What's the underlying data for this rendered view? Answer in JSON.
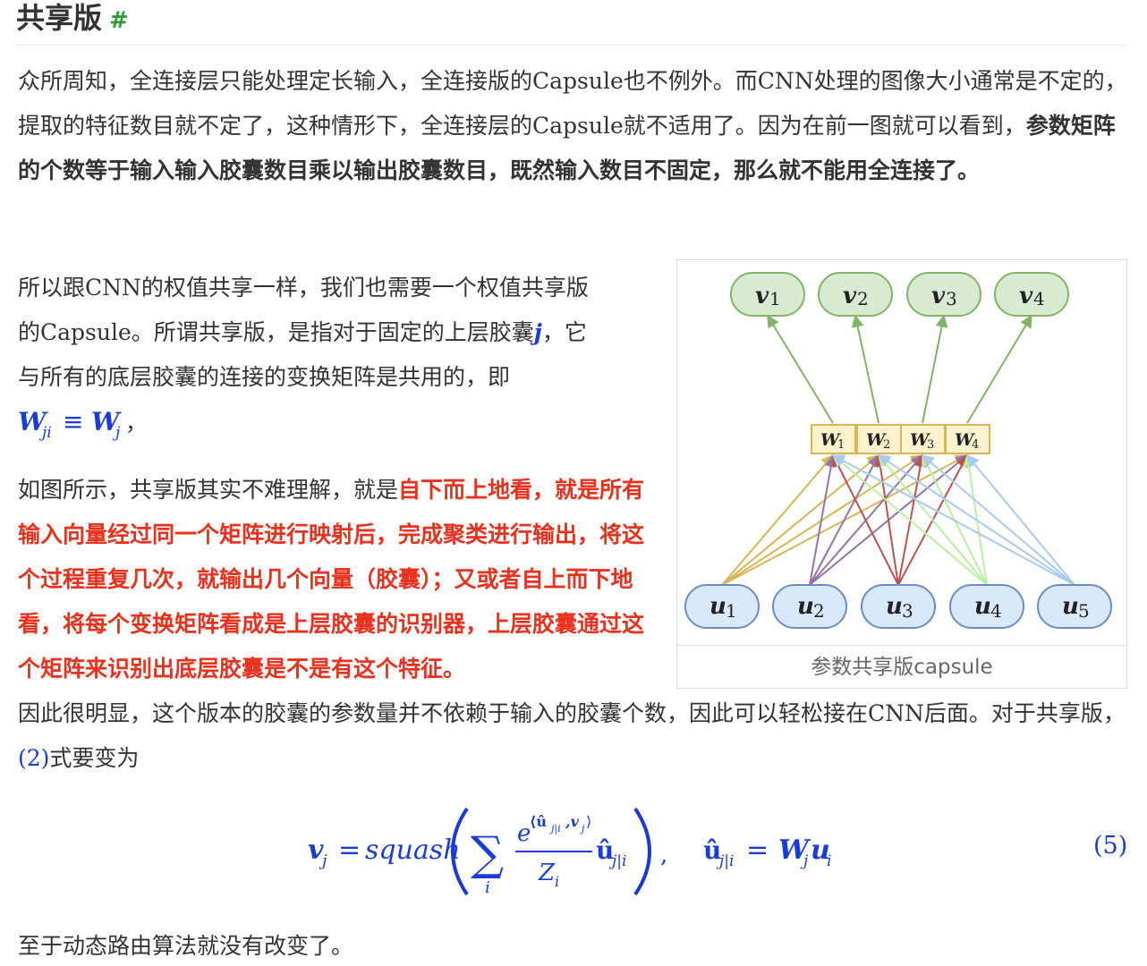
{
  "heading": {
    "title": "共享版",
    "anchor": "#"
  },
  "p1": {
    "text": "众所周知，全连接层只能处理定长输入，全连接版的Capsule也不例外。而CNN处理的图像大小通常是不定的，提取的特征数目就不定了，这种情形下，全连接层的Capsule就不适用了。因为在前一图就可以看到，",
    "bold": "参数矩阵的个数等于输入输入胶囊数目乘以输出胶囊数目，既然输入数目不固定，那么就不能用全连接了。"
  },
  "p2": {
    "line1": "所以跟CNN的权值共享一样，我们也需要一个权值共享版",
    "line2a": "的Capsule。所谓共享版，是指对于固定的上层胶囊",
    "line2_math": "j",
    "line2b": "，它",
    "line3": "与所有的底层胶囊的连接的变换矩阵是共用的，即",
    "math": "W_ji ≡ W_j",
    "math_end": "，"
  },
  "p3": {
    "lead": "如图所示，共享版其实不难理解，就是",
    "red": "自下而上地看，就是所有输入向量经过同一个矩阵进行映射后，完成聚类进行输出，将这个过程重复几次，就输出几个向量（胶囊）；又或者自上而下地看，将每个变换矩阵看成是上层胶囊的识别器，上层胶囊通过这个矩阵来识别出底层胶囊是不是有这个特征。",
    "tail": "因此很明显，这个版本的胶囊的参数量并不依赖于输入的胶囊个数，因此可以轻松接在CNN后面。对于共享版，",
    "link": "(2)",
    "tail2": "式要变为"
  },
  "figure": {
    "caption": "参数共享版capsule",
    "outputs": [
      "v",
      "v",
      "v",
      "v"
    ],
    "output_subs": [
      "1",
      "2",
      "3",
      "4"
    ],
    "weights": [
      "W",
      "W",
      "W",
      "W"
    ],
    "weight_subs": [
      "1",
      "2",
      "3",
      "4"
    ],
    "inputs": [
      "u",
      "u",
      "u",
      "u",
      "u"
    ],
    "input_subs": [
      "1",
      "2",
      "3",
      "4",
      "5"
    ],
    "colors": {
      "output_fill": "#d9ead3",
      "output_stroke": "#82b366",
      "input_fill": "#dae8fc",
      "input_stroke": "#6c8ebf",
      "weight_fill": "#fff2cc",
      "weight_stroke": "#d6b656",
      "arrow_up": "#82b366",
      "from_u1": "#d6b656",
      "from_u2": "#9673a6",
      "from_u3": "#b85450",
      "from_u4": "#b9f0a4",
      "from_u5": "#a9cbf0"
    }
  },
  "equation": {
    "lhs": "v",
    "lhs_sub": "j",
    "eq": "=",
    "func": "squash",
    "sum_sub": "i",
    "exp_base": "e",
    "exp_sup": "⟨û",
    "exp_sup_sub": "j|i",
    "exp_sup_tail": ",v",
    "exp_sup_tail_sub": "j",
    "exp_sup_close": "⟩",
    "denom": "Z",
    "denom_sub": "i",
    "uhat": "û",
    "uhat_sub": "j|i",
    "comma": ",",
    "rhs2_lhs": "û",
    "rhs2_lhs_sub": "j|i",
    "rhs2_W": "W",
    "rhs2_W_sub": "j",
    "rhs2_u": "u",
    "rhs2_u_sub": "i",
    "number": "(5)"
  },
  "p4": {
    "text": "至于动态路由算法就没有改变了。"
  }
}
